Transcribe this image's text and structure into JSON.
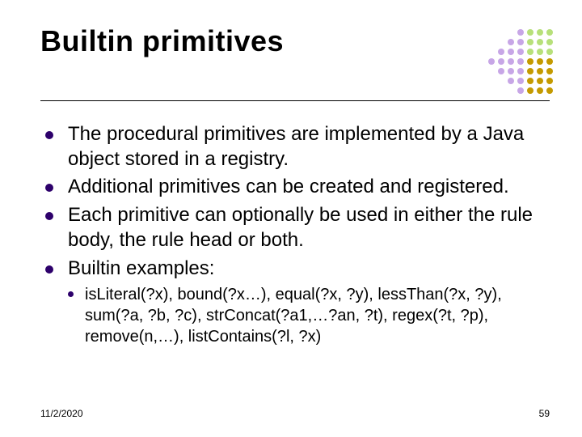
{
  "title": "Builtin primitives",
  "bullets": [
    "The procedural primitives are implemented by a Java object stored in a registry.",
    "Additional primitives can be created and registered.",
    "Each primitive can optionally be used in either the rule body, the rule head or both.",
    "Builtin examples:"
  ],
  "sub_bullet": "isLiteral(?x), bound(?x…), equal(?x, ?y), lessThan(?x, ?y), sum(?a, ?b, ?c), strConcat(?a1,…?an, ?t), regex(?t, ?p), remove(n,…), listContains(?l, ?x)",
  "footer": {
    "date": "11/2/2020",
    "page": "59"
  },
  "dot_colors": [
    "",
    "",
    "",
    "#c7a6e6",
    "#b7e07a",
    "#b7e07a",
    "#b7e07a",
    "",
    "",
    "#c7a6e6",
    "#c7a6e6",
    "#b7e07a",
    "#b7e07a",
    "#b7e07a",
    "",
    "#c7a6e6",
    "#c7a6e6",
    "#c7a6e6",
    "#b7e07a",
    "#b7e07a",
    "#b7e07a",
    "#c7a6e6",
    "#c7a6e6",
    "#c7a6e6",
    "#c7a6e6",
    "#c49a00",
    "#c49a00",
    "#c49a00",
    "",
    "#c7a6e6",
    "#c7a6e6",
    "#c7a6e6",
    "#c49a00",
    "#c49a00",
    "#c49a00",
    "",
    "",
    "#c7a6e6",
    "#c7a6e6",
    "#c49a00",
    "#c49a00",
    "#c49a00",
    "",
    "",
    "",
    "#c7a6e6",
    "#c49a00",
    "#c49a00",
    "#c49a00"
  ]
}
